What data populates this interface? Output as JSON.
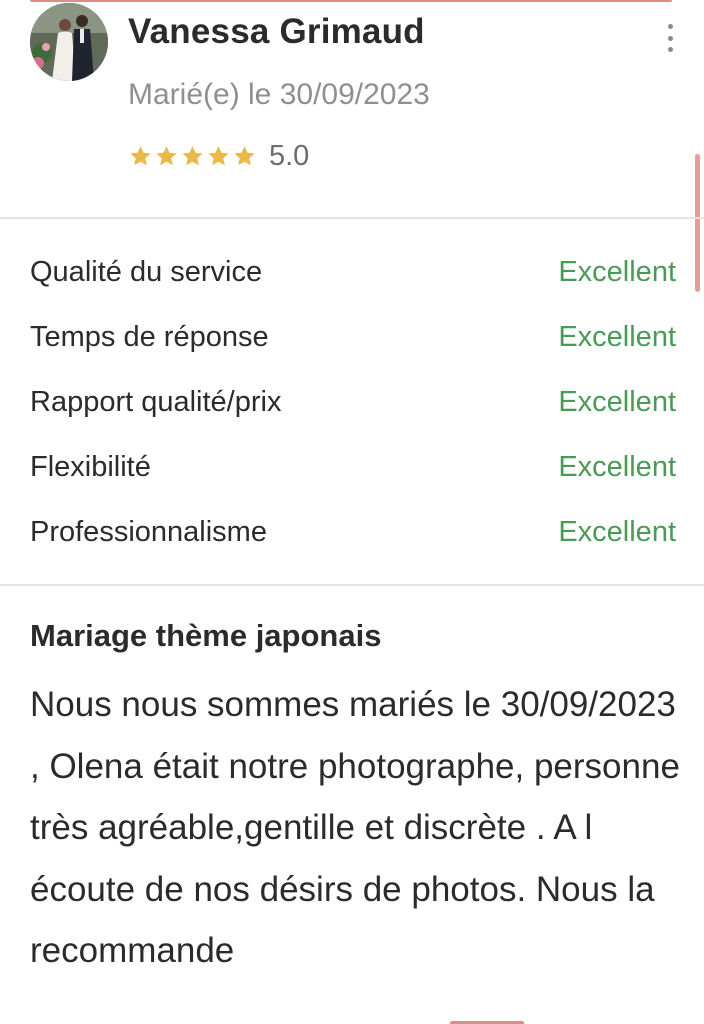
{
  "review": {
    "reviewer_name": "Vanessa Grimaud",
    "married_date": "Marié(e) le 30/09/2023",
    "stars": 5,
    "rating_value": "5.0",
    "title": "Mariage thème japonais",
    "body": "Nous nous sommes mariés le 30/09/2023 , Olena était notre photographe, personne très agréable,gentille et discrète . A l écoute de nos désirs de photos. Nous la recommande"
  },
  "criteria": [
    {
      "label": "Qualité du service",
      "score": "Excellent"
    },
    {
      "label": "Temps de réponse",
      "score": "Excellent"
    },
    {
      "label": "Rapport qualité/prix",
      "score": "Excellent"
    },
    {
      "label": "Flexibilité",
      "score": "Excellent"
    },
    {
      "label": "Professionnalisme",
      "score": "Excellent"
    }
  ],
  "colors": {
    "star": "#e9b949",
    "score": "#4a9a57",
    "accent": "#e6898a",
    "muted_text": "#8f8f8f"
  },
  "icons": {
    "star": "star-icon",
    "more": "more-vertical-icon",
    "avatar": "avatar-photo"
  }
}
